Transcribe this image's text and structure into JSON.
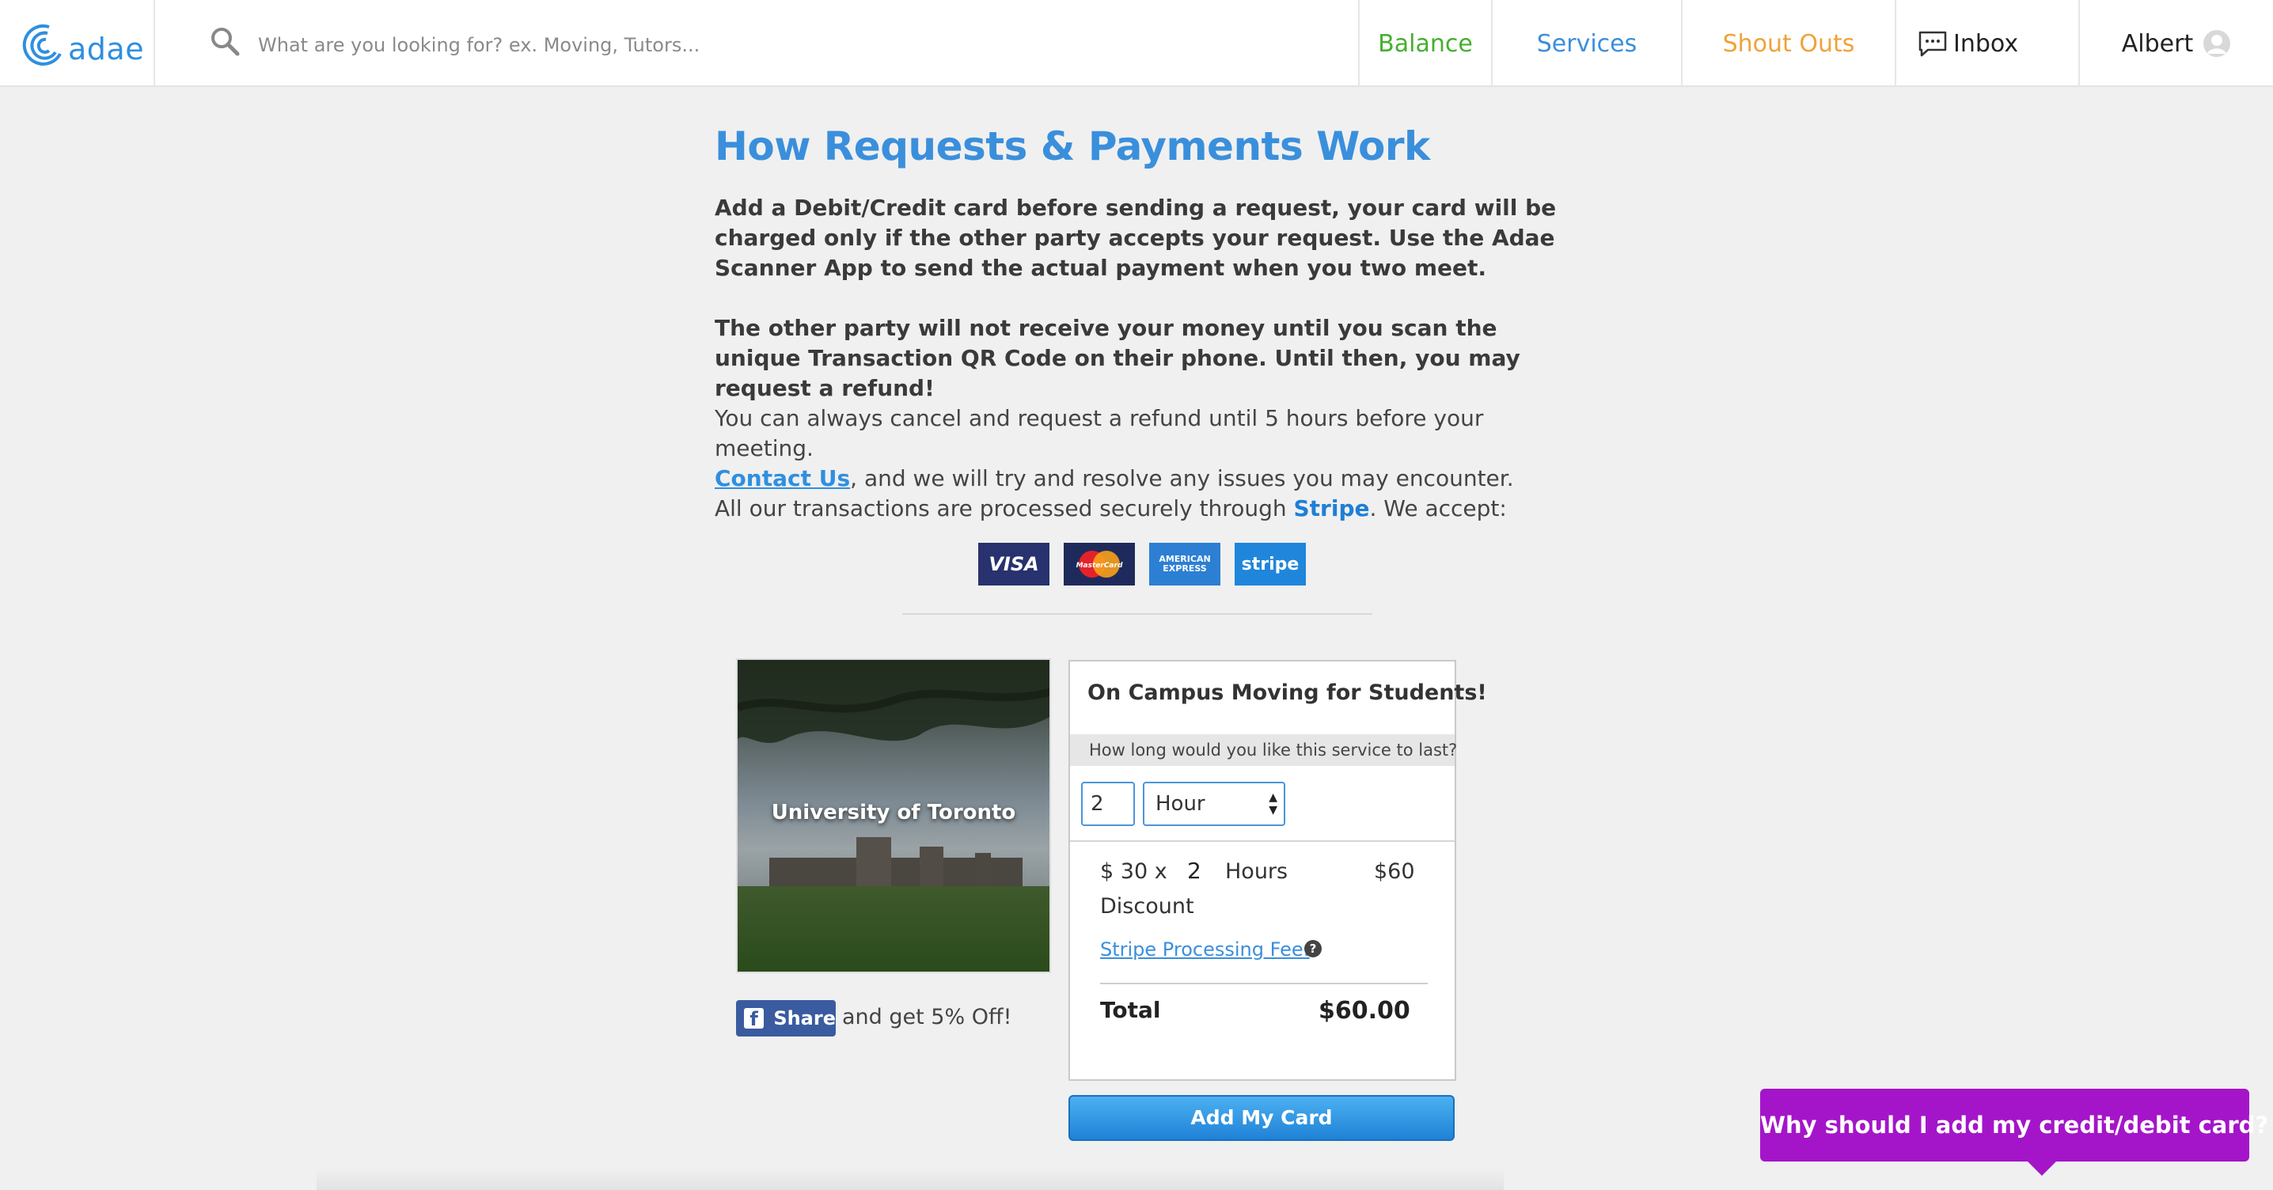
{
  "header": {
    "logo_text": "adae",
    "search_placeholder": "What are you looking for? ex. Moving, Tutors...",
    "nav": {
      "balance": "Balance",
      "services": "Services",
      "shout_outs": "Shout Outs",
      "inbox": "Inbox",
      "user": "Albert"
    },
    "colors": {
      "balance": "#44b02e",
      "services": "#3b8fdc",
      "shout_outs": "#f0a237"
    }
  },
  "main": {
    "title": "How Requests & Payments Work",
    "para1": "Add a Debit/Credit card before sending a request, your card will be charged only if the other party accepts your request. Use the Adae Scanner App to send the actual payment when you two meet.",
    "para2": "The other party will not receive your money until you scan the unique Transaction QR Code on their phone. Until then, you may request a refund!",
    "para3_line1": "You can always cancel and request a refund until 5 hours before your meeting.",
    "contact_link": "Contact Us",
    "para3_rest": ", and we will try and resolve any issues you may encounter.",
    "para4_prefix": "All our transactions are processed securely through ",
    "stripe_word": "Stripe",
    "para4_suffix": ". We accept:",
    "card_logos": {
      "visa": "VISA",
      "mastercard": "MasterCard",
      "amex_line1": "AMERICAN",
      "amex_line2": "EXPRESS",
      "stripe": "stripe"
    }
  },
  "service": {
    "image_label": "University of Toronto",
    "share_label": "Share",
    "share_text": "and get 5% Off!"
  },
  "order": {
    "title": "On Campus Moving for Students!",
    "question": "How long would you like this service to last?",
    "quantity": "2",
    "unit_selected": "Hour",
    "rate": "$ 30 x",
    "qty_display": "2",
    "unit_plural": "Hours",
    "subtotal": "$60",
    "discount_label": "Discount",
    "fee_label": "Stripe Processing Fee:",
    "fee_help": "?",
    "total_label": "Total",
    "total_value": "$60.00",
    "add_card_button": "Add My Card"
  },
  "help_bubble": {
    "text": "Why should I add my credit/debit card?",
    "color": "#a415c9"
  }
}
